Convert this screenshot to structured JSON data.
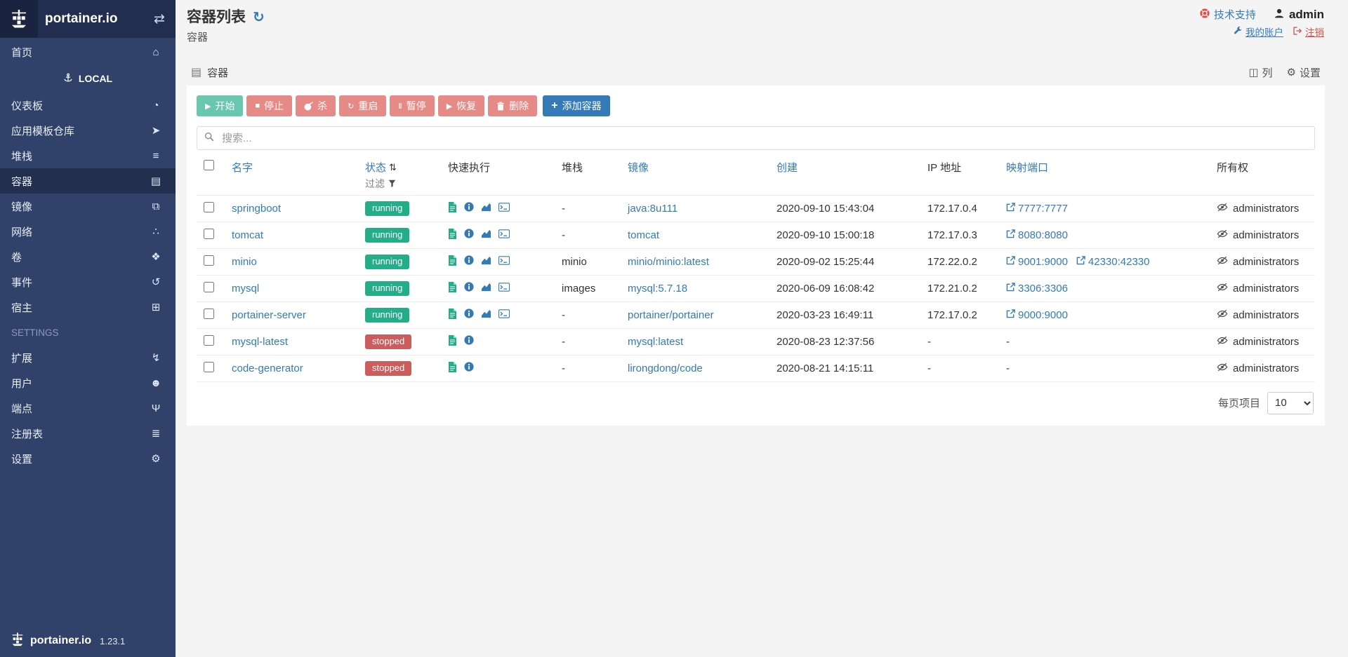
{
  "colors": {
    "sidebar_bg": "#30426a",
    "sidebar_active_bg": "#232f4e",
    "link_blue": "#337ab7",
    "running_green": "#23ae89",
    "stopped_red": "#cd5c5c",
    "danger_button": "#d9534f",
    "primary_button": "#337ab7",
    "page_bg": "#f4f4f4"
  },
  "icons": {
    "toggle": "⇄",
    "home": "⌂",
    "dashboard": "◔",
    "app_templates": "➤",
    "stacks": "≡",
    "containers": "▤",
    "images": "⧉",
    "networks": "∴",
    "volumes": "❖",
    "events": "↺",
    "host": "⊞",
    "extensions": "↯",
    "users": "☻",
    "endpoints": "Ψ",
    "registries": "≣",
    "settings": "⚙",
    "refresh": "↻",
    "columns": "◫",
    "sort": "⇅",
    "plus": "+",
    "play": "▶",
    "stop": "■",
    "restart": "↻",
    "pause": "Ⅱ",
    "resume": "▶"
  },
  "sidebar": {
    "logo_text": "portainer.io",
    "version": "1.23.1",
    "items": [
      {
        "id": "home",
        "label": "首页",
        "icon": "home"
      },
      {
        "type": "local",
        "label": "LOCAL"
      },
      {
        "id": "dashboard",
        "label": "仪表板",
        "icon": "dashboard"
      },
      {
        "id": "app-templates",
        "label": "应用模板仓库",
        "icon": "app_templates"
      },
      {
        "id": "stacks",
        "label": "堆栈",
        "icon": "stacks"
      },
      {
        "id": "containers",
        "label": "容器",
        "icon": "containers",
        "active": true
      },
      {
        "id": "images",
        "label": "镜像",
        "icon": "images"
      },
      {
        "id": "networks",
        "label": "网络",
        "icon": "networks"
      },
      {
        "id": "volumes",
        "label": "卷",
        "icon": "volumes"
      },
      {
        "id": "events",
        "label": "事件",
        "icon": "events"
      },
      {
        "id": "host",
        "label": "宿主",
        "icon": "host"
      },
      {
        "type": "section",
        "label": "SETTINGS"
      },
      {
        "id": "extensions",
        "label": "扩展",
        "icon": "extensions"
      },
      {
        "id": "users",
        "label": "用户",
        "icon": "users"
      },
      {
        "id": "endpoints",
        "label": "端点",
        "icon": "endpoints"
      },
      {
        "id": "registries",
        "label": "注册表",
        "icon": "registries"
      },
      {
        "id": "settings",
        "label": "设置",
        "icon": "settings"
      }
    ]
  },
  "header": {
    "title": "容器列表",
    "subtitle": "容器",
    "support": "技术支持",
    "user": "admin",
    "my_account": "我的账户",
    "logout": "注销"
  },
  "widget": {
    "title": "容器",
    "columns_label": "列",
    "settings_label": "设置"
  },
  "toolbar": {
    "buttons": [
      {
        "id": "start",
        "label": "开始",
        "icon": "play",
        "style": "success"
      },
      {
        "id": "stop",
        "label": "停止",
        "icon": "stop",
        "style": "danger"
      },
      {
        "id": "kill",
        "label": "杀",
        "icon": "bomb",
        "style": "danger"
      },
      {
        "id": "restart",
        "label": "重启",
        "icon": "restart",
        "style": "danger"
      },
      {
        "id": "pause",
        "label": "暂停",
        "icon": "pause",
        "style": "danger"
      },
      {
        "id": "resume",
        "label": "恢复",
        "icon": "resume",
        "style": "danger"
      },
      {
        "id": "remove",
        "label": "删除",
        "icon": "trash",
        "style": "danger"
      }
    ],
    "add_button": "添加容器"
  },
  "search": {
    "placeholder": "搜索..."
  },
  "table": {
    "headers": {
      "name": "名字",
      "state": "状态",
      "filter": "过滤",
      "quick_actions": "快速执行",
      "stack": "堆栈",
      "image": "镜像",
      "created": "创建",
      "ip": "IP 地址",
      "ports": "映射端口",
      "ownership": "所有权"
    },
    "rows": [
      {
        "name": "springboot",
        "state": "running",
        "actions": [
          "logs",
          "inspect",
          "stats",
          "console"
        ],
        "stack": "-",
        "image": "java:8u111",
        "created": "2020-09-10 15:43:04",
        "ip": "172.17.0.4",
        "ports": [
          "7777:7777"
        ],
        "ownership": "administrators"
      },
      {
        "name": "tomcat",
        "state": "running",
        "actions": [
          "logs",
          "inspect",
          "stats",
          "console"
        ],
        "stack": "-",
        "image": "tomcat",
        "created": "2020-09-10 15:00:18",
        "ip": "172.17.0.3",
        "ports": [
          "8080:8080"
        ],
        "ownership": "administrators"
      },
      {
        "name": "minio",
        "state": "running",
        "actions": [
          "logs",
          "inspect",
          "stats",
          "console"
        ],
        "stack": "minio",
        "image": "minio/minio:latest",
        "created": "2020-09-02 15:25:44",
        "ip": "172.22.0.2",
        "ports": [
          "9001:9000",
          "42330:42330"
        ],
        "ownership": "administrators"
      },
      {
        "name": "mysql",
        "state": "running",
        "actions": [
          "logs",
          "inspect",
          "stats",
          "console"
        ],
        "stack": "images",
        "image": "mysql:5.7.18",
        "created": "2020-06-09 16:08:42",
        "ip": "172.21.0.2",
        "ports": [
          "3306:3306"
        ],
        "ownership": "administrators"
      },
      {
        "name": "portainer-server",
        "state": "running",
        "actions": [
          "logs",
          "inspect",
          "stats",
          "console"
        ],
        "stack": "-",
        "image": "portainer/portainer",
        "created": "2020-03-23 16:49:11",
        "ip": "172.17.0.2",
        "ports": [
          "9000:9000"
        ],
        "ownership": "administrators"
      },
      {
        "name": "mysql-latest",
        "state": "stopped",
        "actions": [
          "logs",
          "inspect"
        ],
        "stack": "-",
        "image": "mysql:latest",
        "created": "2020-08-23 12:37:56",
        "ip": "-",
        "ports": "-",
        "ownership": "administrators"
      },
      {
        "name": "code-generator",
        "state": "stopped",
        "actions": [
          "logs",
          "inspect"
        ],
        "stack": "-",
        "image": "lirongdong/code",
        "created": "2020-08-21 14:15:11",
        "ip": "-",
        "ports": "-",
        "ownership": "administrators"
      }
    ]
  },
  "pagination": {
    "label": "每页项目",
    "value": "10"
  }
}
